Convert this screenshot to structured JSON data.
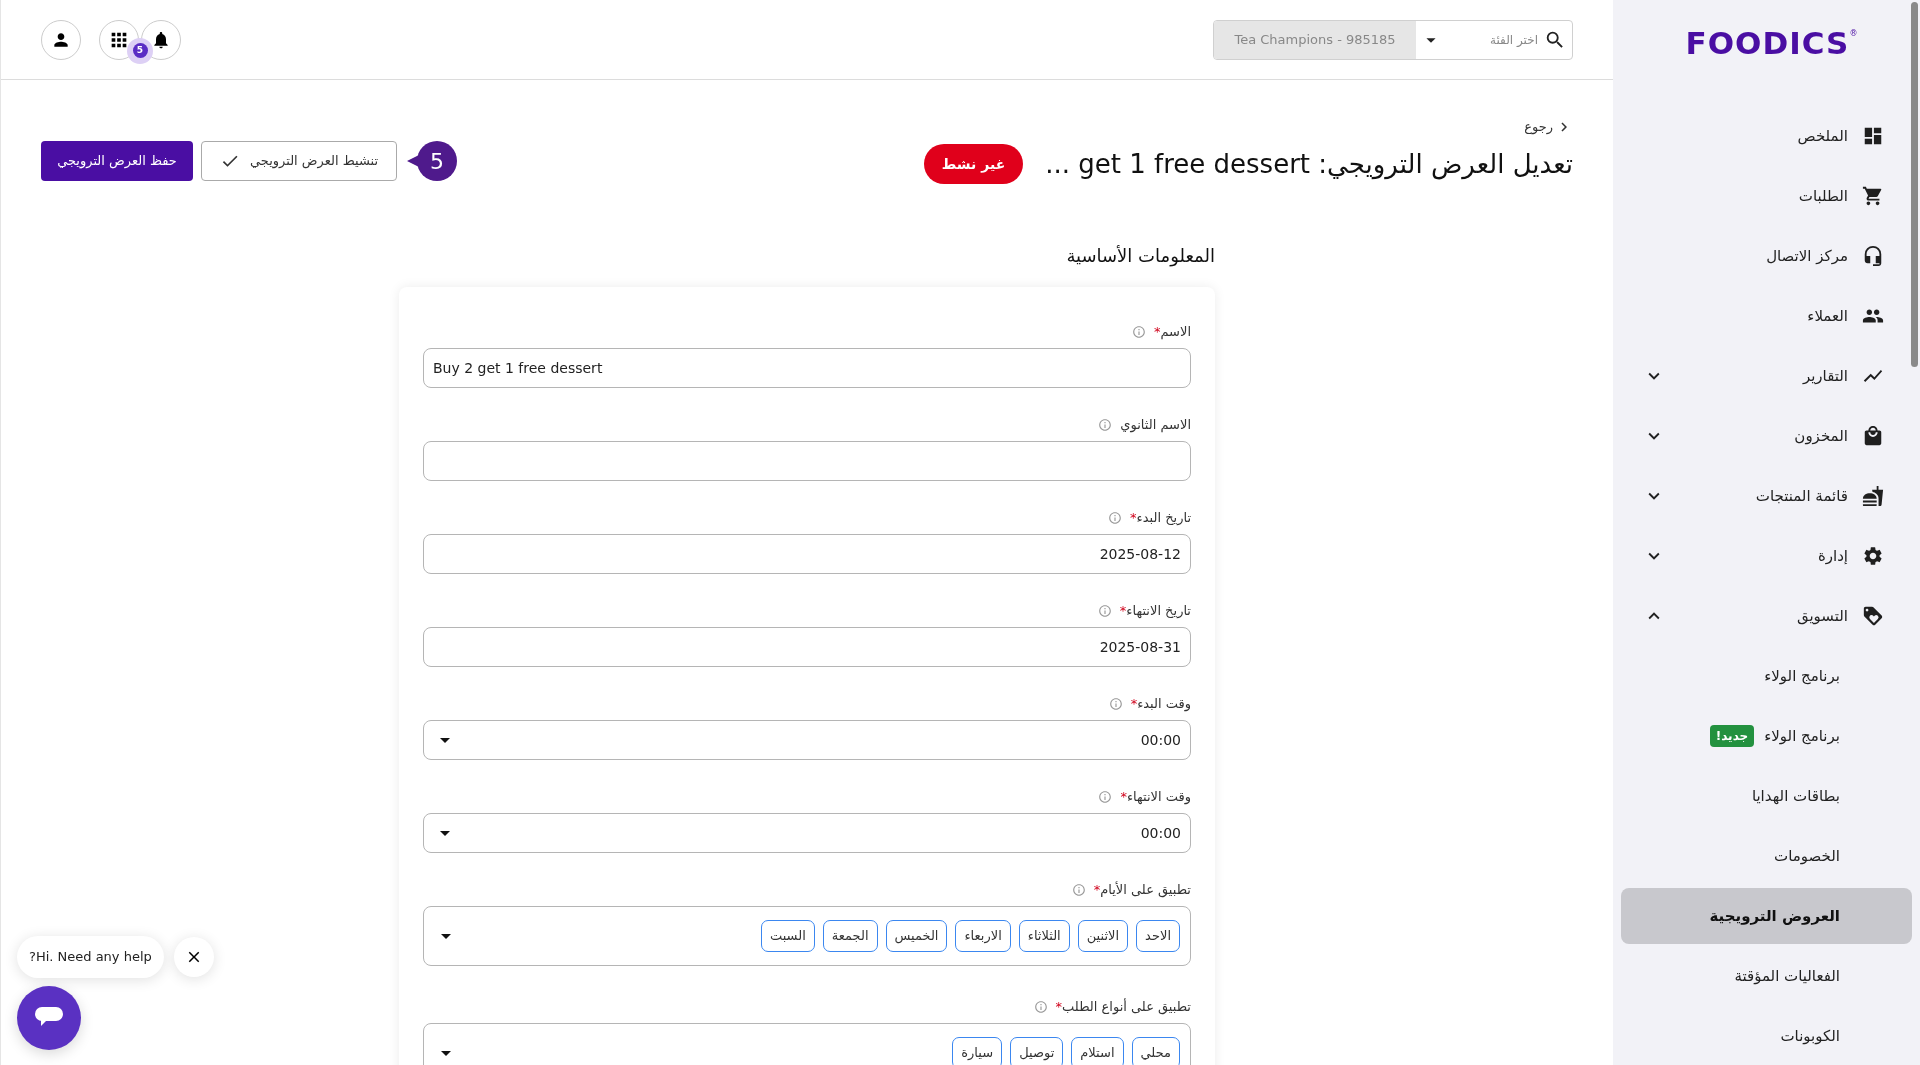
{
  "topbar": {
    "search": {
      "placeholder": "اختر الفئة"
    },
    "business": "Tea Champions - 985185",
    "notifications_count": "5"
  },
  "sidebar": {
    "logo": "FOODICS",
    "logo_mark": "®",
    "items": [
      {
        "label": "الملخص",
        "kind": "link"
      },
      {
        "label": "الطلبات",
        "kind": "link"
      },
      {
        "label": "مركز الاتصال",
        "kind": "link"
      },
      {
        "label": "العملاء",
        "kind": "link"
      },
      {
        "label": "التقارير",
        "kind": "group",
        "expanded": false
      },
      {
        "label": "المخزون",
        "kind": "group",
        "expanded": false
      },
      {
        "label": "قائمة المنتجات",
        "kind": "group",
        "expanded": false
      },
      {
        "label": "إدارة",
        "kind": "group",
        "expanded": false
      },
      {
        "label": "التسويق",
        "kind": "group",
        "expanded": true,
        "children": [
          {
            "label": "برنامج الولاء",
            "selected": false
          },
          {
            "label": "برنامج الولاء",
            "badge": "جديد!",
            "selected": false
          },
          {
            "label": "بطاقات الهدايا",
            "selected": false
          },
          {
            "label": "الخصومات",
            "selected": false
          },
          {
            "label": "العروض الترويجية",
            "selected": true
          },
          {
            "label": "الفعاليات المؤقتة",
            "selected": false
          },
          {
            "label": "الكوبونات",
            "selected": false
          }
        ]
      }
    ]
  },
  "header": {
    "back": "رجوع",
    "title": "تعديل العرض الترويجي: get 1 free dessert ...",
    "status": "غير نشط",
    "step": "5",
    "activate_button": "تنشيط العرض الترويجي",
    "save_button": "حفظ العرض الترويجي"
  },
  "section_title": "المعلومات الأساسية",
  "required_mark": "*",
  "fields": [
    {
      "kind": "text",
      "label": "الاسم",
      "required": true,
      "value": "Buy 2 get 1 free dessert"
    },
    {
      "kind": "text",
      "label": "الاسم الثانوي",
      "required": false
    },
    {
      "kind": "date",
      "label": "تاريخ البدء",
      "required": true,
      "value": "2025-08-12"
    },
    {
      "kind": "date",
      "label": "تاريخ الانتهاء",
      "required": true,
      "value": "2025-08-31"
    },
    {
      "kind": "select",
      "label": "وقت البدء",
      "required": true,
      "value": "00:00"
    },
    {
      "kind": "select",
      "label": "وقت الانتهاء",
      "required": true,
      "value": "00:00"
    },
    {
      "kind": "chips",
      "label": "تطبيق على الأيام",
      "required": true,
      "chips": [
        "الاحد",
        "الاثنين",
        "الثلاثاء",
        "الاربعاء",
        "الخميس",
        "الجمعة",
        "السبت"
      ]
    },
    {
      "kind": "chips",
      "label": "تطبيق على أنواع الطلب",
      "required": true,
      "chips": [
        "محلي",
        "استلام",
        "توصيل",
        "سيارة"
      ]
    }
  ],
  "chat": {
    "message": "?Hi. Need any help"
  }
}
